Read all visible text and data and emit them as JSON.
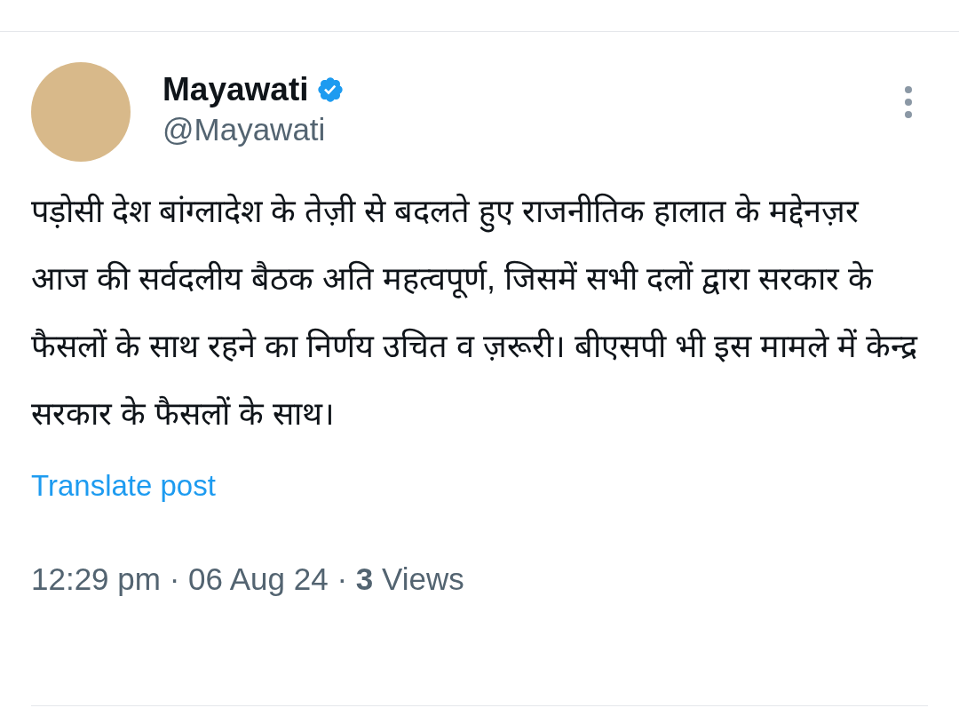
{
  "author": {
    "name": "Mayawati",
    "handle": "@Mayawati",
    "verified": true
  },
  "post": {
    "text": "पड़ोसी देश बांग्लादेश के तेज़ी से बदलते हुए राजनीतिक हालात के मद्देनज़र आज की सर्वदलीय बैठक अति महत्वपूर्ण, जिसमें सभी दलों द्वारा सरकार के फैसलों के साथ रहने का निर्णय उचित व ज़रूरी। बीएसपी भी इस मामले में केन्द्र सरकार के फैसलों के साथ।",
    "translate_link": "Translate post",
    "meta": "12:29 pm · 06 Aug 24 · **3** Views"
  }
}
